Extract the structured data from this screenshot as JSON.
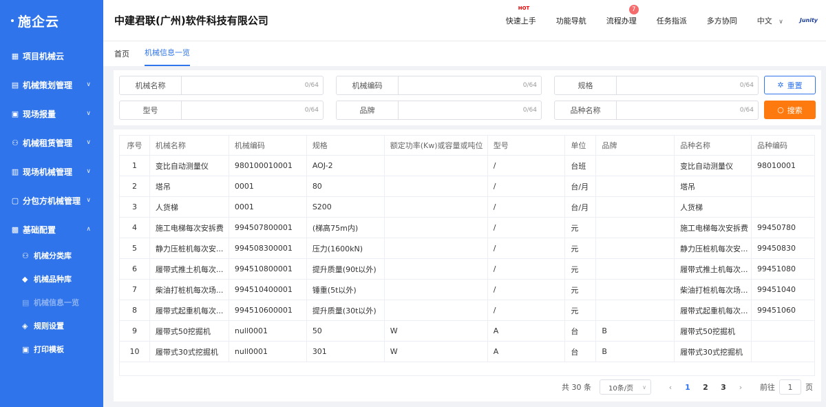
{
  "sidebar": {
    "logo": "施企云",
    "items": [
      {
        "label": "项目机械云",
        "icon": "grid-icon",
        "glyph": "▦",
        "chev": ""
      },
      {
        "label": "机械策划管理",
        "icon": "plan-icon",
        "glyph": "▤",
        "chev": "∨"
      },
      {
        "label": "现场报量",
        "icon": "report-icon",
        "glyph": "▣",
        "chev": "∨"
      },
      {
        "label": "机械租赁管理",
        "icon": "lease-icon",
        "glyph": "⚇",
        "chev": "∨"
      },
      {
        "label": "现场机械管理",
        "icon": "site-icon",
        "glyph": "▥",
        "chev": "∨"
      },
      {
        "label": "分包方机械管理",
        "icon": "subcontract-icon",
        "glyph": "▢",
        "chev": "∨"
      },
      {
        "label": "基础配置",
        "icon": "config-icon",
        "glyph": "▩",
        "chev": "∧"
      }
    ],
    "subitems": [
      {
        "label": "机械分类库",
        "icon": "tree-icon",
        "glyph": "⚇"
      },
      {
        "label": "机械品种库",
        "icon": "tag-icon",
        "glyph": "◆"
      },
      {
        "label": "机械信息一览",
        "icon": "list-icon",
        "glyph": "▤"
      },
      {
        "label": "规则设置",
        "icon": "cube-icon",
        "glyph": "◈"
      },
      {
        "label": "打印模板",
        "icon": "print-icon",
        "glyph": "▣"
      }
    ]
  },
  "header": {
    "company": "中建君联(广州)软件科技有限公司",
    "nav": [
      "快速上手",
      "功能导航",
      "流程办理",
      "任务指派",
      "多方协同"
    ],
    "hot": "HOT",
    "badge": "7",
    "lang": "中文",
    "brand": "Junity"
  },
  "tabs": [
    "首页",
    "机械信息一览"
  ],
  "search": {
    "fields": [
      {
        "label": "机械名称",
        "count": "0/64"
      },
      {
        "label": "机械编码",
        "count": "0/64"
      },
      {
        "label": "规格",
        "count": "0/64"
      },
      {
        "label": "型号",
        "count": "0/64"
      },
      {
        "label": "品牌",
        "count": "0/64"
      },
      {
        "label": "品种名称",
        "count": "0/64"
      }
    ],
    "reset": "重置",
    "search": "搜索"
  },
  "table": {
    "headers": [
      "序号",
      "机械名称",
      "机械编码",
      "规格",
      "额定功率(Kw)或容量或吨位",
      "型号",
      "单位",
      "品牌",
      "品种名称",
      "品种编码"
    ],
    "rows": [
      [
        "1",
        "变比自动测量仪",
        "980100010001",
        "AOJ-2",
        "",
        "/",
        "台班",
        "",
        "变比自动测量仪",
        "98010001"
      ],
      [
        "2",
        "塔吊",
        "0001",
        "80",
        "",
        "/",
        "台/月",
        "",
        "塔吊",
        ""
      ],
      [
        "3",
        "人货梯",
        "0001",
        "S200",
        "",
        "/",
        "台/月",
        "",
        "人货梯",
        ""
      ],
      [
        "4",
        "施工电梯每次安拆费",
        "994507800001",
        "(梯高75m内)",
        "",
        "/",
        "元",
        "",
        "施工电梯每次安拆费",
        "99450780"
      ],
      [
        "5",
        "静力压桩机每次安...",
        "994508300001",
        "压力(1600kN)",
        "",
        "/",
        "元",
        "",
        "静力压桩机每次安...",
        "99450830"
      ],
      [
        "6",
        "履带式推土机每次...",
        "994510800001",
        "提升质量(90t以外)",
        "",
        "/",
        "元",
        "",
        "履带式推土机每次...",
        "99451080"
      ],
      [
        "7",
        "柴油打桩机每次场...",
        "994510400001",
        "锤重(5t以外)",
        "",
        "/",
        "元",
        "",
        "柴油打桩机每次场...",
        "99451040"
      ],
      [
        "8",
        "履带式起重机每次...",
        "994510600001",
        "提升质量(30t以外)",
        "",
        "/",
        "元",
        "",
        "履带式起重机每次...",
        "99451060"
      ],
      [
        "9",
        "履带式50挖掘机",
        "null0001",
        "50",
        "W",
        "A",
        "台",
        "B",
        "履带式50挖掘机",
        ""
      ],
      [
        "10",
        "履带式30式挖掘机",
        "null0001",
        "301",
        "W",
        "A",
        "台",
        "B",
        "履带式30式挖掘机",
        ""
      ]
    ]
  },
  "pager": {
    "total": "共 30 条",
    "size": "10条/页",
    "pages": [
      "1",
      "2",
      "3"
    ],
    "goto": "前往",
    "page_value": "1",
    "page_suffix": "页"
  }
}
